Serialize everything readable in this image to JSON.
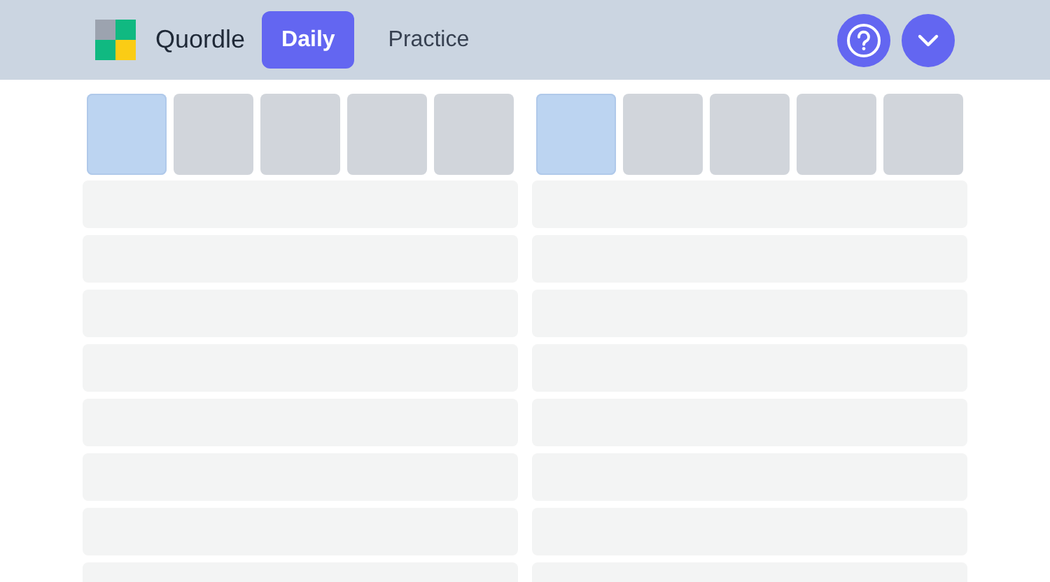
{
  "header": {
    "brand": "Quordle",
    "tabs": [
      {
        "label": "Daily",
        "selected": true
      },
      {
        "label": "Practice",
        "selected": false
      }
    ]
  },
  "boards": [
    {
      "tiles": [
        {
          "selected": true
        },
        {
          "selected": false
        },
        {
          "selected": false
        },
        {
          "selected": false
        },
        {
          "selected": false
        }
      ],
      "rows": [
        {
          "kind": "empty"
        },
        {
          "kind": "empty"
        },
        {
          "kind": "empty"
        },
        {
          "kind": "empty"
        },
        {
          "kind": "empty"
        },
        {
          "kind": "empty"
        },
        {
          "kind": "empty"
        },
        {
          "kind": "empty"
        }
      ]
    },
    {
      "tiles": [
        {
          "selected": true
        },
        {
          "selected": false
        },
        {
          "selected": false
        },
        {
          "selected": false
        },
        {
          "selected": false
        }
      ],
      "rows": [
        {
          "kind": "empty"
        },
        {
          "kind": "empty"
        },
        {
          "kind": "empty"
        },
        {
          "kind": "empty"
        },
        {
          "kind": "empty"
        },
        {
          "kind": "empty"
        },
        {
          "kind": "empty"
        },
        {
          "kind": "empty"
        }
      ]
    }
  ]
}
